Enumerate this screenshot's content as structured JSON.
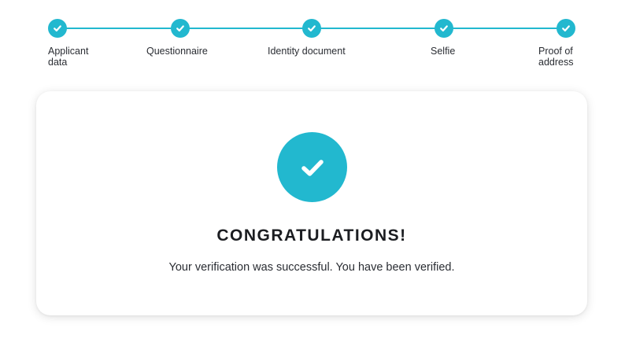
{
  "theme": {
    "accent": "#22b8cf",
    "text": "#1f2227",
    "card_background": "#ffffff"
  },
  "stepper": {
    "steps": [
      {
        "label": "Applicant data",
        "status": "completed",
        "icon": "check-icon"
      },
      {
        "label": "Questionnaire",
        "status": "completed",
        "icon": "check-icon"
      },
      {
        "label": "Identity document",
        "status": "completed",
        "icon": "check-icon"
      },
      {
        "label": "Selfie",
        "status": "completed",
        "icon": "check-icon"
      },
      {
        "label": "Proof of address",
        "status": "completed",
        "icon": "check-icon"
      }
    ]
  },
  "result": {
    "icon": "success-check-icon",
    "title": "CONGRATULATIONS!",
    "message": "Your verification was successful. You have been verified."
  }
}
